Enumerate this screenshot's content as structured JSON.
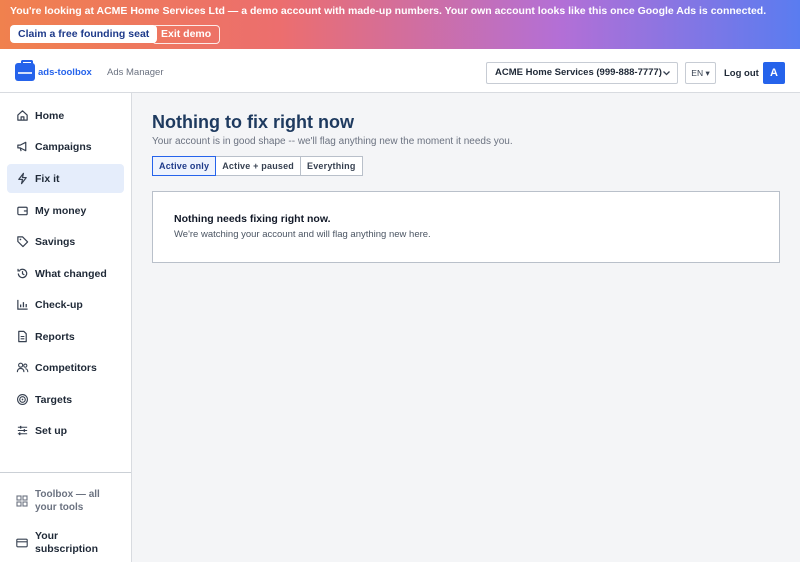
{
  "banner": {
    "prefix": "You're looking at ",
    "company": "ACME Home Services Ltd",
    "suffix": " — a demo account with made-up numbers. Your own account looks like this once Google Ads is connected.",
    "claim_label": "Claim a free founding seat",
    "exit_label": "Exit demo"
  },
  "header": {
    "logo_text": "ads-toolbox",
    "app_name": "Ads Manager",
    "account": "ACME Home Services (999-888-7777)",
    "language": "EN ▾",
    "logout_label": "Log out",
    "avatar_initial": "A"
  },
  "sidebar": {
    "items": [
      {
        "label": "Home",
        "icon": "home-icon"
      },
      {
        "label": "Campaigns",
        "icon": "megaphone-icon"
      },
      {
        "label": "Fix it",
        "icon": "lightning-icon",
        "active": true
      },
      {
        "label": "My money",
        "icon": "wallet-icon"
      },
      {
        "label": "Savings",
        "icon": "tag-icon"
      },
      {
        "label": "What changed",
        "icon": "history-icon"
      },
      {
        "label": "Check-up",
        "icon": "bar-chart-icon"
      },
      {
        "label": "Reports",
        "icon": "document-icon"
      },
      {
        "label": "Competitors",
        "icon": "users-icon"
      },
      {
        "label": "Targets",
        "icon": "target-icon"
      },
      {
        "label": "Set up",
        "icon": "sliders-icon"
      }
    ],
    "footer": {
      "toolbox_line1": "Toolbox — all",
      "toolbox_line2": "your tools",
      "subscription_line1": "Your",
      "subscription_line2": "subscription"
    }
  },
  "main": {
    "title": "Nothing to fix right now",
    "subtitle": "Your account is in good shape -- we'll flag anything new the moment it needs you.",
    "filters": [
      {
        "label": "Active only",
        "selected": true
      },
      {
        "label": "Active + paused",
        "selected": false
      },
      {
        "label": "Everything",
        "selected": false
      }
    ],
    "card": {
      "title": "Nothing needs fixing right now.",
      "text": "We're watching your account and will flag anything new here."
    }
  },
  "colors": {
    "accent": "#2563eb",
    "title": "#1e3a5f",
    "active_nav_bg": "#e5edfb"
  }
}
